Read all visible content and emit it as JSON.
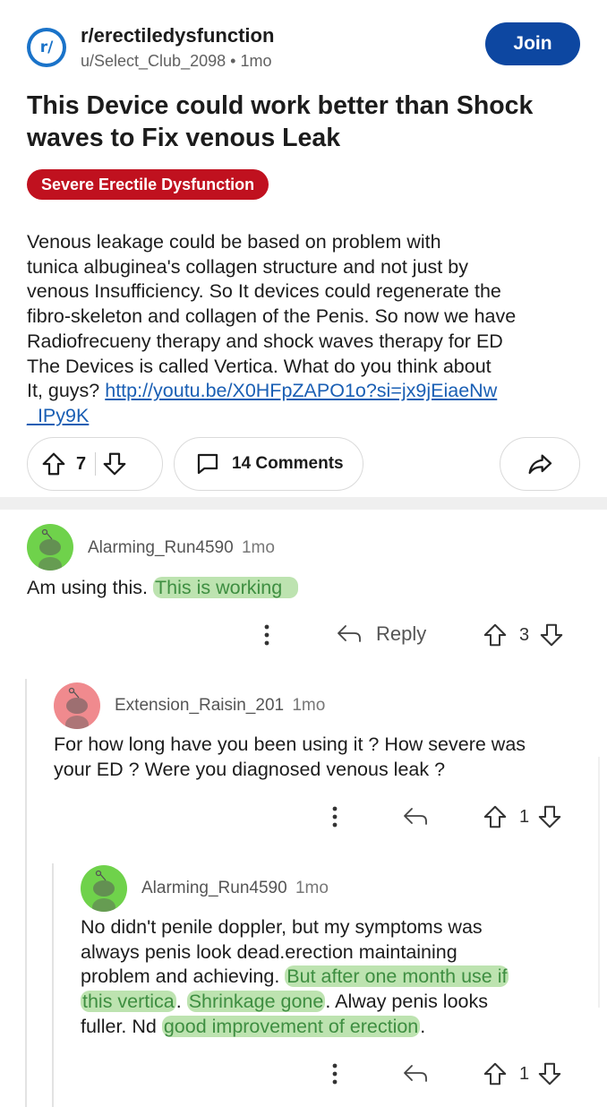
{
  "header": {
    "subreddit_icon_text": "r/",
    "subreddit": "r/erectiledysfunction",
    "author": "u/Select_Club_2098",
    "separator": "•",
    "age": "1mo",
    "join_label": "Join"
  },
  "post": {
    "title": "This Device could work better than Shock waves to Fix venous Leak",
    "title_lines": [
      "This Device could work better than Shock",
      "waves to Fix venous Leak"
    ],
    "flair": "Severe Erectile Dysfunction",
    "body_lines": [
      "Venous leakage could be based on problem with",
      "tunica albuginea's collagen structure and not just by",
      "venous Insufficiency. So It devices could regenerate the",
      "fibro-skeleton and collagen of the Penis. So now we have",
      "Radiofrecueny therapy and shock waves therapy for ED",
      "The Devices is called Vertica. What do you think about",
      "It, guys? "
    ],
    "link_part1": "http://youtu.be/X0HFpZAPO1o?si=jx9jEiaeNw",
    "link_part2": "_IPy9K",
    "votes": "7",
    "comments_label": "14 Comments"
  },
  "comments": [
    {
      "author": "Alarming_Run4590",
      "age": "1mo",
      "text_plain": "Am using this. ",
      "text_highlight": "This is working",
      "reply_label": "Reply",
      "votes": "3"
    },
    {
      "author": "Extension_Raisin_201",
      "age": "1mo",
      "lines": [
        "For how long have you been using it ? How severe was",
        "your ED ? Were you diagnosed venous leak ?"
      ],
      "votes": "1"
    },
    {
      "author": "Alarming_Run4590",
      "age": "1mo",
      "line1": "No didn't penile doppler, but my symptoms  was",
      "line2": "always  penis  look dead.erection  maintaining",
      "line3_plain": "problem and achieving. ",
      "line3_hl": "But after one month use if",
      "line4_hl1": "this vertica",
      "line4_mid": ".  ",
      "line4_hl2": "Shrinkage gone",
      "line4_end": ". Alway penis  looks",
      "line5_plain": "fuller. Nd ",
      "line5_hl": "good improvement of   erection",
      "line5_end": ".",
      "votes": "1"
    }
  ],
  "colors": {
    "join": "#0d47a1",
    "flair": "#c0111f",
    "link": "#1a5fb4",
    "highlight": "#bde3b0",
    "avatar_green": "#6fd24b",
    "avatar_pink": "#f08a8e"
  },
  "icons": [
    "upvote-icon",
    "downvote-icon",
    "comment-icon",
    "share-icon",
    "more-icon",
    "reply-icon"
  ]
}
